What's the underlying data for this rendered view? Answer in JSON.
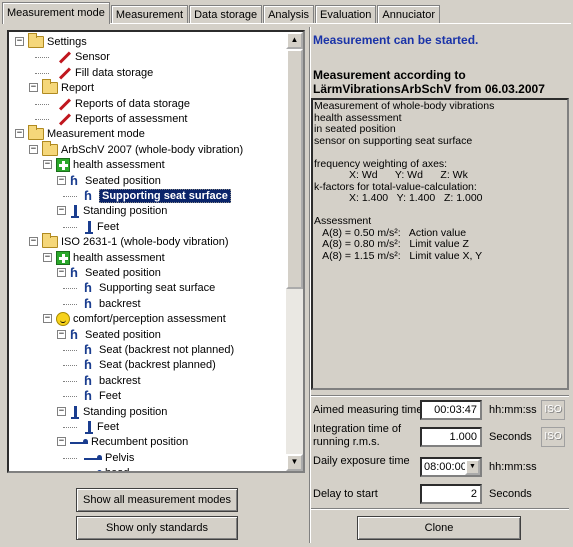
{
  "tabs": [
    "Measurement mode",
    "Measurement",
    "Data storage",
    "Analysis",
    "Evaluation",
    "Annuciator"
  ],
  "active_tab": 0,
  "tree": [
    {
      "label": "Settings",
      "icon": "folder-icon"
    },
    {
      "label": "Sensor",
      "icon": "pencil-icon"
    },
    {
      "label": "Fill data storage",
      "icon": "pencil-icon"
    },
    {
      "label": "Report",
      "icon": "folder-icon"
    },
    {
      "label": "Reports of data storage",
      "icon": "pencil-icon"
    },
    {
      "label": "Reports of assessment",
      "icon": "pencil-icon"
    },
    {
      "label": "Measurement mode",
      "icon": "folder-icon"
    },
    {
      "label": "ArbSchV 2007 (whole-body vibration)",
      "icon": "folder-icon"
    },
    {
      "label": "health assessment",
      "icon": "health-cross-icon"
    },
    {
      "label": "Seated position",
      "icon": "seated-person-icon"
    },
    {
      "label": "Supporting seat surface",
      "icon": "seated-person-icon",
      "selected": true
    },
    {
      "label": "Standing position",
      "icon": "standing-person-icon"
    },
    {
      "label": "Feet",
      "icon": "standing-person-icon"
    },
    {
      "label": "ISO 2631-1 (whole-body vibration)",
      "icon": "folder-icon"
    },
    {
      "label": "health assessment",
      "icon": "health-cross-icon"
    },
    {
      "label": "Seated position",
      "icon": "seated-person-icon"
    },
    {
      "label": "Supporting seat surface",
      "icon": "seated-person-icon"
    },
    {
      "label": "backrest",
      "icon": "seated-person-icon"
    },
    {
      "label": "comfort/perception assessment",
      "icon": "smiley-icon"
    },
    {
      "label": "Seated position",
      "icon": "seated-person-icon"
    },
    {
      "label": "Seat (backrest not planned)",
      "icon": "seated-person-icon"
    },
    {
      "label": "Seat (backrest planned)",
      "icon": "seated-person-icon"
    },
    {
      "label": "backrest",
      "icon": "seated-person-icon"
    },
    {
      "label": "Feet",
      "icon": "seated-person-icon"
    },
    {
      "label": "Standing position",
      "icon": "standing-person-icon"
    },
    {
      "label": "Feet",
      "icon": "standing-person-icon"
    },
    {
      "label": "Recumbent position",
      "icon": "recumbent-person-icon"
    },
    {
      "label": "Pelvis",
      "icon": "recumbent-person-icon"
    },
    {
      "label": "head",
      "icon": "recumbent-person-icon"
    }
  ],
  "buttons": {
    "show_all": "Show all measurement modes",
    "show_standards": "Show only standards",
    "clone": "Clone",
    "iso": "ISO"
  },
  "right": {
    "status": "Measurement can be started.",
    "heading_line1": "Measurement according to",
    "heading_line2": "LärmVibrationsArbSchV from 06.03.2007",
    "description": "Measurement of whole-body vibrations\nhealth assessment\nin seated position\nsensor on supporting seat surface\n\nfrequency weighting of axes:\n            X: Wd      Y: Wd      Z: Wk\nk-factors for total-value-calculation:\n            X: 1.400   Y: 1.400   Z: 1.000\n\nAssessment\n   A(8) = 0.50 m/s²:   Action value\n   A(8) = 0.80 m/s²:   Limit value Z\n   A(8) = 1.15 m/s²:   Limit value X, Y"
  },
  "settings": {
    "aimed_label": "Aimed measuring time",
    "aimed_value": "00:03:47",
    "aimed_unit": "hh:mm:ss",
    "integration_label_1": "Integration time of",
    "integration_label_2": "running r.m.s.",
    "integration_value": "1.000",
    "integration_unit": "Seconds",
    "daily_label": "Daily exposure time",
    "daily_value": "08:00:00",
    "daily_unit": "hh:mm:ss",
    "delay_label": "Delay to start",
    "delay_value": "2",
    "delay_unit": "Seconds"
  }
}
